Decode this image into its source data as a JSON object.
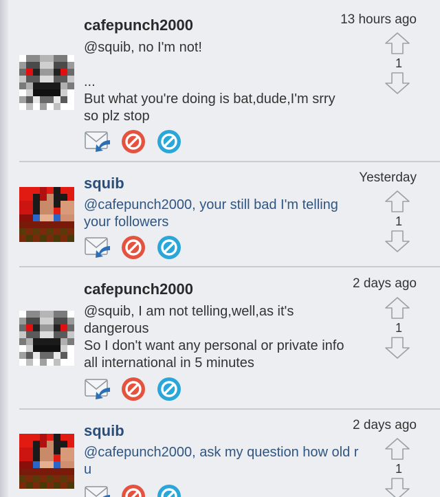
{
  "posts": [
    {
      "username": "cafepunch2000",
      "time": "13 hours ago",
      "body": "@squib, no I'm not!\n\n...\nBut what you're doing is bat,dude,I'm srry so plz stop",
      "votes": "1",
      "avatar": "skull-avatar",
      "style": "dark"
    },
    {
      "username": "squib",
      "time": "Yesterday",
      "body": "@cafepunch2000, your still bad I'm telling your followers",
      "votes": "1",
      "avatar": "red-face-avatar",
      "style": "blue"
    },
    {
      "username": "cafepunch2000",
      "time": "2 days ago",
      "body": "@squib, I am not telling,well,as it's dangerous\nSo I don't want any personal or private info all international in 5 minutes",
      "votes": "1",
      "avatar": "skull-avatar",
      "style": "dark"
    },
    {
      "username": "squib",
      "time": "2 days ago",
      "body": "@cafepunch2000, ask my question how old r u",
      "votes": "1",
      "avatar": "red-face-avatar",
      "style": "blue"
    }
  ],
  "icons": {
    "reply": "reply-icon",
    "block": "block-icon",
    "ignore": "ignore-icon",
    "upvote": "upvote-arrow-icon",
    "downvote": "downvote-arrow-icon"
  },
  "colors": {
    "block_red": "#e4533f",
    "ignore_blue": "#2aa6d8",
    "reply_blue": "#2d6fb5"
  }
}
